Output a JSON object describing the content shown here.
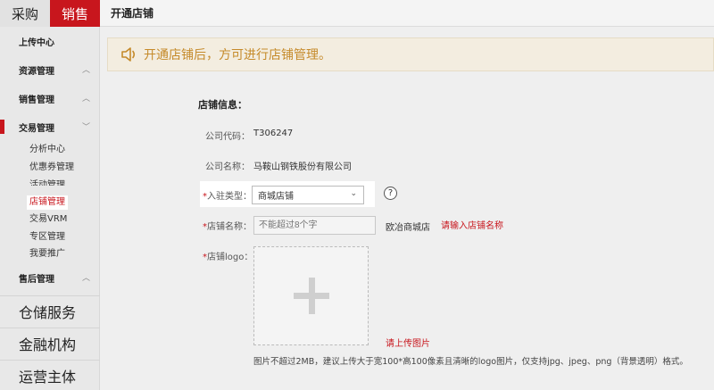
{
  "top_tabs": [
    {
      "label": "采购",
      "active": false
    },
    {
      "label": "销售",
      "active": true
    }
  ],
  "header": {
    "title": "开通店铺"
  },
  "sidebar": {
    "groups": [
      {
        "label": "上传中心"
      },
      {
        "label": "资源管理"
      },
      {
        "label": "销售管理"
      },
      {
        "label": "交易管理",
        "current": true
      },
      {
        "label": "售后管理"
      }
    ],
    "sub_items": [
      {
        "label": "分析中心"
      },
      {
        "label": "优惠券管理"
      },
      {
        "label": "活动管理"
      },
      {
        "label": "店铺管理",
        "active": true
      },
      {
        "label": "交易VRM"
      },
      {
        "label": "专区管理"
      },
      {
        "label": "我要推广"
      }
    ],
    "services": [
      {
        "label": "仓储服务"
      },
      {
        "label": "金融机构"
      },
      {
        "label": "运营主体"
      }
    ]
  },
  "notice": {
    "text": "开通店铺后，方可进行店铺管理。",
    "icon": "speaker-icon"
  },
  "form": {
    "section_title": "店铺信息：",
    "company_code_label": "公司代码：",
    "company_code": "T306247",
    "company_name_label": "公司名称：",
    "company_name": "马鞍山钢铁股份有限公司",
    "required_mark": "*",
    "type_label": "入驻类型：",
    "type_value": "商城店铺",
    "help_symbol": "?",
    "store_name_label": "店铺名称：",
    "store_name_placeholder": "不能超过8个字",
    "store_name_suffix": "欧冶商城店",
    "store_name_error": "请输入店铺名称",
    "logo_label": "店铺logo：",
    "logo_error": "请上传图片",
    "logo_hint": "图片不超过2MB，建议上传大于宽100*高100像素且清晰的logo图片，仅支持jpg、jpeg、png（背景透明）格式。"
  },
  "colors": {
    "brand_red": "#c8161d",
    "notice_text": "#c58a2a",
    "notice_bg": "#f3ede0"
  }
}
